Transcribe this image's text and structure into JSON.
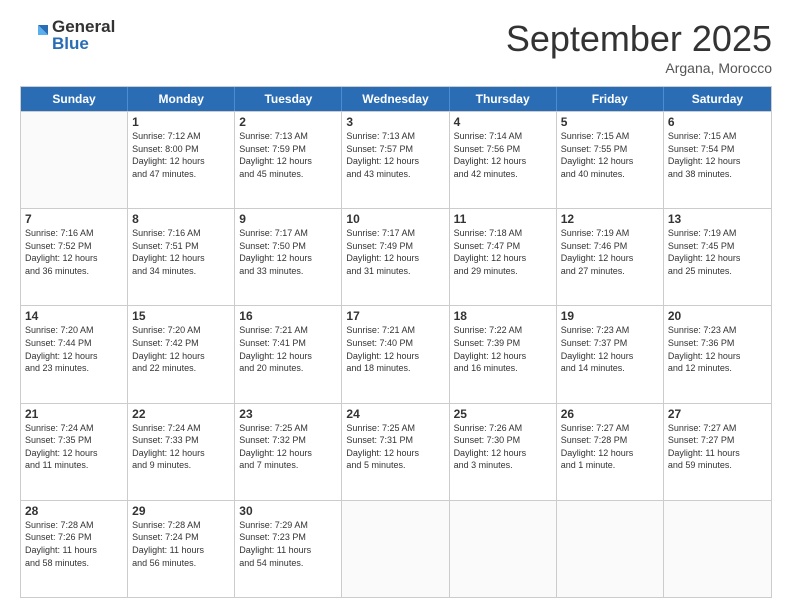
{
  "logo": {
    "general": "General",
    "blue": "Blue"
  },
  "title": "September 2025",
  "subtitle": "Argana, Morocco",
  "days": [
    "Sunday",
    "Monday",
    "Tuesday",
    "Wednesday",
    "Thursday",
    "Friday",
    "Saturday"
  ],
  "rows": [
    [
      {
        "day": "",
        "info": ""
      },
      {
        "day": "1",
        "info": "Sunrise: 7:12 AM\nSunset: 8:00 PM\nDaylight: 12 hours\nand 47 minutes."
      },
      {
        "day": "2",
        "info": "Sunrise: 7:13 AM\nSunset: 7:59 PM\nDaylight: 12 hours\nand 45 minutes."
      },
      {
        "day": "3",
        "info": "Sunrise: 7:13 AM\nSunset: 7:57 PM\nDaylight: 12 hours\nand 43 minutes."
      },
      {
        "day": "4",
        "info": "Sunrise: 7:14 AM\nSunset: 7:56 PM\nDaylight: 12 hours\nand 42 minutes."
      },
      {
        "day": "5",
        "info": "Sunrise: 7:15 AM\nSunset: 7:55 PM\nDaylight: 12 hours\nand 40 minutes."
      },
      {
        "day": "6",
        "info": "Sunrise: 7:15 AM\nSunset: 7:54 PM\nDaylight: 12 hours\nand 38 minutes."
      }
    ],
    [
      {
        "day": "7",
        "info": "Sunrise: 7:16 AM\nSunset: 7:52 PM\nDaylight: 12 hours\nand 36 minutes."
      },
      {
        "day": "8",
        "info": "Sunrise: 7:16 AM\nSunset: 7:51 PM\nDaylight: 12 hours\nand 34 minutes."
      },
      {
        "day": "9",
        "info": "Sunrise: 7:17 AM\nSunset: 7:50 PM\nDaylight: 12 hours\nand 33 minutes."
      },
      {
        "day": "10",
        "info": "Sunrise: 7:17 AM\nSunset: 7:49 PM\nDaylight: 12 hours\nand 31 minutes."
      },
      {
        "day": "11",
        "info": "Sunrise: 7:18 AM\nSunset: 7:47 PM\nDaylight: 12 hours\nand 29 minutes."
      },
      {
        "day": "12",
        "info": "Sunrise: 7:19 AM\nSunset: 7:46 PM\nDaylight: 12 hours\nand 27 minutes."
      },
      {
        "day": "13",
        "info": "Sunrise: 7:19 AM\nSunset: 7:45 PM\nDaylight: 12 hours\nand 25 minutes."
      }
    ],
    [
      {
        "day": "14",
        "info": "Sunrise: 7:20 AM\nSunset: 7:44 PM\nDaylight: 12 hours\nand 23 minutes."
      },
      {
        "day": "15",
        "info": "Sunrise: 7:20 AM\nSunset: 7:42 PM\nDaylight: 12 hours\nand 22 minutes."
      },
      {
        "day": "16",
        "info": "Sunrise: 7:21 AM\nSunset: 7:41 PM\nDaylight: 12 hours\nand 20 minutes."
      },
      {
        "day": "17",
        "info": "Sunrise: 7:21 AM\nSunset: 7:40 PM\nDaylight: 12 hours\nand 18 minutes."
      },
      {
        "day": "18",
        "info": "Sunrise: 7:22 AM\nSunset: 7:39 PM\nDaylight: 12 hours\nand 16 minutes."
      },
      {
        "day": "19",
        "info": "Sunrise: 7:23 AM\nSunset: 7:37 PM\nDaylight: 12 hours\nand 14 minutes."
      },
      {
        "day": "20",
        "info": "Sunrise: 7:23 AM\nSunset: 7:36 PM\nDaylight: 12 hours\nand 12 minutes."
      }
    ],
    [
      {
        "day": "21",
        "info": "Sunrise: 7:24 AM\nSunset: 7:35 PM\nDaylight: 12 hours\nand 11 minutes."
      },
      {
        "day": "22",
        "info": "Sunrise: 7:24 AM\nSunset: 7:33 PM\nDaylight: 12 hours\nand 9 minutes."
      },
      {
        "day": "23",
        "info": "Sunrise: 7:25 AM\nSunset: 7:32 PM\nDaylight: 12 hours\nand 7 minutes."
      },
      {
        "day": "24",
        "info": "Sunrise: 7:25 AM\nSunset: 7:31 PM\nDaylight: 12 hours\nand 5 minutes."
      },
      {
        "day": "25",
        "info": "Sunrise: 7:26 AM\nSunset: 7:30 PM\nDaylight: 12 hours\nand 3 minutes."
      },
      {
        "day": "26",
        "info": "Sunrise: 7:27 AM\nSunset: 7:28 PM\nDaylight: 12 hours\nand 1 minute."
      },
      {
        "day": "27",
        "info": "Sunrise: 7:27 AM\nSunset: 7:27 PM\nDaylight: 11 hours\nand 59 minutes."
      }
    ],
    [
      {
        "day": "28",
        "info": "Sunrise: 7:28 AM\nSunset: 7:26 PM\nDaylight: 11 hours\nand 58 minutes."
      },
      {
        "day": "29",
        "info": "Sunrise: 7:28 AM\nSunset: 7:24 PM\nDaylight: 11 hours\nand 56 minutes."
      },
      {
        "day": "30",
        "info": "Sunrise: 7:29 AM\nSunset: 7:23 PM\nDaylight: 11 hours\nand 54 minutes."
      },
      {
        "day": "",
        "info": ""
      },
      {
        "day": "",
        "info": ""
      },
      {
        "day": "",
        "info": ""
      },
      {
        "day": "",
        "info": ""
      }
    ]
  ]
}
